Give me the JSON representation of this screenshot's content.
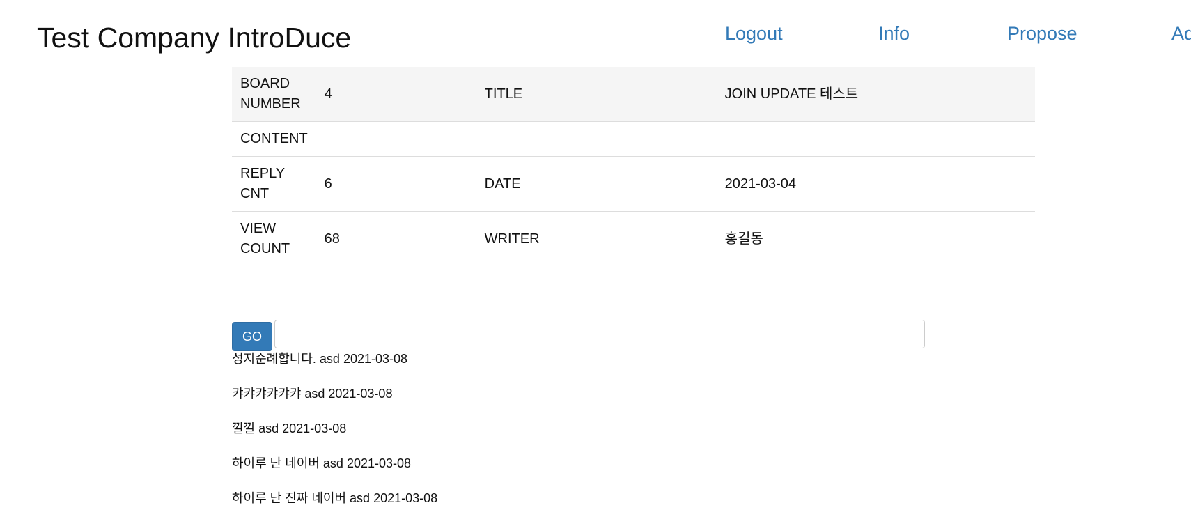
{
  "header": {
    "brand": "Test Company IntroDuce",
    "nav": [
      "Logout",
      "Info",
      "Propose",
      "Ad"
    ]
  },
  "board": {
    "rows": [
      [
        "BOARD NUMBER",
        "4",
        "TITLE",
        "JOIN UPDATE 테스트"
      ],
      [
        "CONTENT",
        "",
        "",
        ""
      ],
      [
        "REPLY CNT",
        "6",
        "DATE",
        "2021-03-04"
      ],
      [
        "VIEW COUNT",
        "68",
        "WRITER",
        "홍길동"
      ]
    ]
  },
  "reply_form": {
    "button_label": "GO",
    "input_value": "",
    "input_placeholder": ""
  },
  "replies": [
    "성지순례합니다. asd 2021-03-08",
    "캬캬캬캬캬캬 asd 2021-03-08",
    "낄낄 asd 2021-03-08",
    "하이루 난 네이버 asd 2021-03-08",
    "하이루 난 진짜 네이버 asd 2021-03-08"
  ],
  "colors": {
    "link": "#337ab7",
    "button": "#337ab7",
    "table_header_bg": "#f5f5f5"
  }
}
